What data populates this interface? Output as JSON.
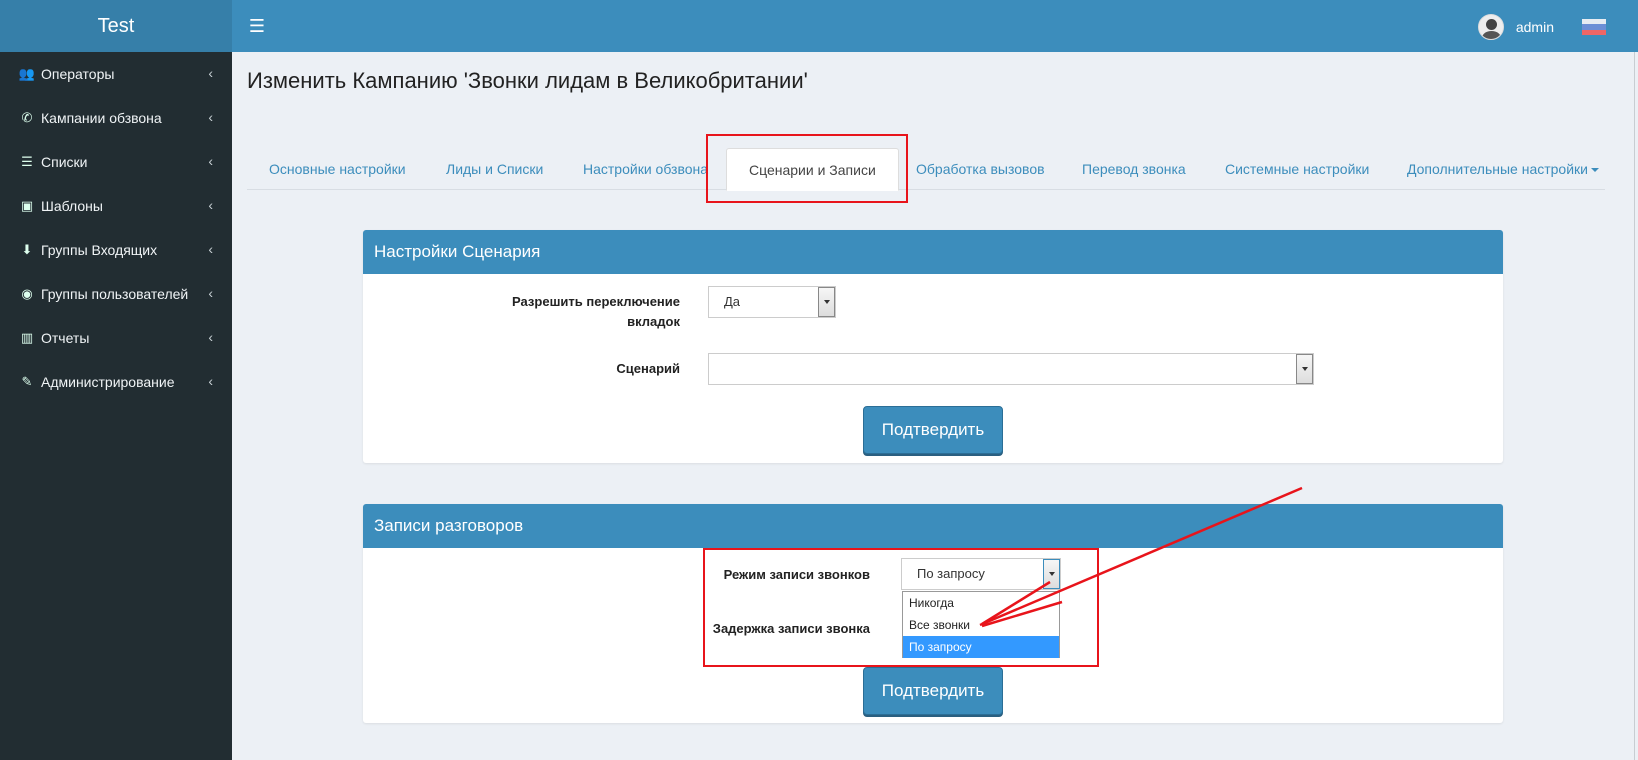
{
  "app": {
    "logo": "Test",
    "user_name": "admin"
  },
  "sidebar": {
    "items": [
      {
        "label": "Операторы",
        "icon": "users-icon",
        "glyph": "👥"
      },
      {
        "label": "Кампании обзвона",
        "icon": "phone-icon",
        "glyph": "✆"
      },
      {
        "label": "Списки",
        "icon": "list-icon",
        "glyph": "☰"
      },
      {
        "label": "Шаблоны",
        "icon": "template-icon",
        "glyph": "▣"
      },
      {
        "label": "Группы Входящих",
        "icon": "arrow-down-icon",
        "glyph": "⬇"
      },
      {
        "label": "Группы пользователей",
        "icon": "user-circle-icon",
        "glyph": "◉"
      },
      {
        "label": "Отчеты",
        "icon": "bar-chart-icon",
        "glyph": "▥"
      },
      {
        "label": "Администрирование",
        "icon": "wrench-icon",
        "glyph": "✎"
      }
    ],
    "chevron": "‹"
  },
  "page": {
    "title": "Изменить Кампанию 'Звонки лидам в Великобритании'"
  },
  "tabs": [
    "Основные настройки",
    "Лиды и Списки",
    "Настройки обзвона",
    "Сценарии и Записи",
    "Обработка вызовов",
    "Перевод звонка",
    "Системные настройки",
    "Дополнительные настройки"
  ],
  "scenario_panel": {
    "title": "Настройки Сценария",
    "allow_tab_switch_label_line1": "Разрешить переключение",
    "allow_tab_switch_label_line2": "вкладок",
    "allow_tab_switch_value": "Да",
    "scenario_label": "Сценарий",
    "scenario_value": "",
    "submit_label": "Подтвердить"
  },
  "recording_panel": {
    "title": "Записи разговоров",
    "mode_label": "Режим записи звонков",
    "mode_value": "По запросу",
    "delay_label": "Задержка записи звонка",
    "options": [
      "Никогда",
      "Все звонки",
      "По запросу"
    ],
    "selected_option": "По запросу",
    "submit_label": "Подтвердить"
  },
  "colors": {
    "header": "#3c8dbc",
    "logo_bg": "#367fa9",
    "sidebar": "#222d32",
    "annotation_red": "#e8141b",
    "option_highlight": "#3399ff"
  }
}
